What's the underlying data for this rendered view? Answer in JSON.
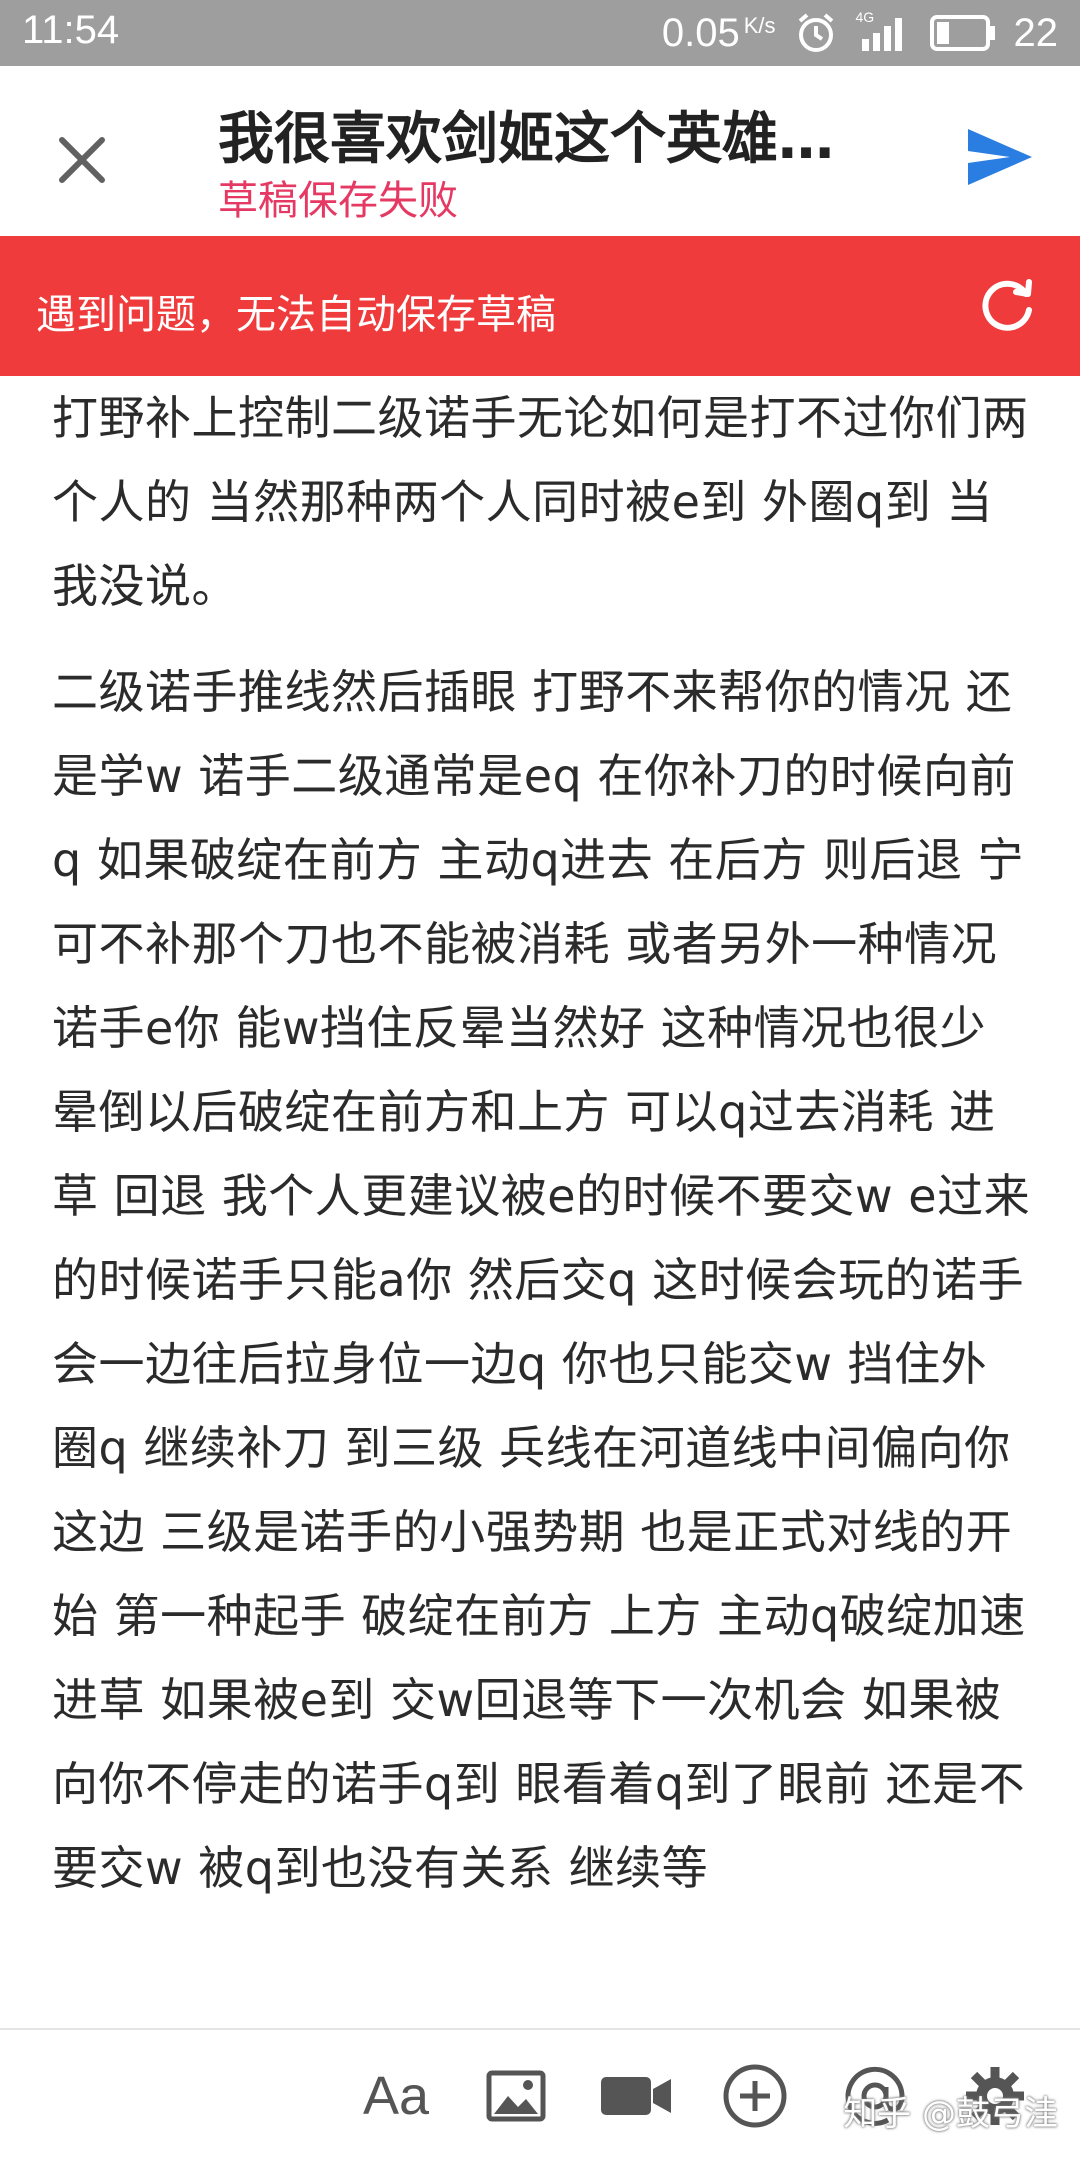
{
  "status_bar": {
    "time": "11:54",
    "net_speed": "0.05",
    "net_unit": "K/s",
    "network_type": "4G",
    "battery": "22",
    "icons": [
      "alarm-icon",
      "signal-icon",
      "battery-icon"
    ]
  },
  "app_bar": {
    "title": "我很喜欢剑姬这个英雄…",
    "subtitle": "草稿保存失败",
    "close_icon": "close-icon",
    "send_icon": "send-icon"
  },
  "banner": {
    "message": "遇到问题，无法自动保存草稿",
    "icon": "refresh-icon"
  },
  "content": {
    "paragraphs": [
      "打野补上控制二级诺手无论如何是打不过你们两个人的 当然那种两个人同时被e到 外圈q到 当我没说。",
      "二级诺手推线然后插眼 打野不来帮你的情况 还是学w 诺手二级通常是eq 在你补刀的时候向前q 如果破绽在前方 主动q进去 在后方 则后退 宁可不补那个刀也不能被消耗 或者另外一种情况 诺手e你 能w挡住反晕当然好 这种情况也很少 晕倒以后破绽在前方和上方 可以q过去消耗 进草 回退 我个人更建议被e的时候不要交w e过来的时候诺手只能a你 然后交q 这时候会玩的诺手会一边往后拉身位一边q 你也只能交w 挡住外圈q 继续补刀 到三级 兵线在河道线中间偏向你这边 三级是诺手的小强势期 也是正式对线的开始 第一种起手 破绽在前方 上方 主动q破绽加速进草 如果被e到 交w回退等下一次机会 如果被向你不停走的诺手q到 眼看着q到了眼前 还是不要交w 被q到也没有关系 继续等"
    ]
  },
  "toolbar": {
    "font_label": "Aa",
    "items": [
      "font-icon",
      "image-icon",
      "video-icon",
      "add-icon",
      "mention-icon",
      "settings-icon"
    ]
  },
  "watermark": "知乎 @鼓弓洼"
}
